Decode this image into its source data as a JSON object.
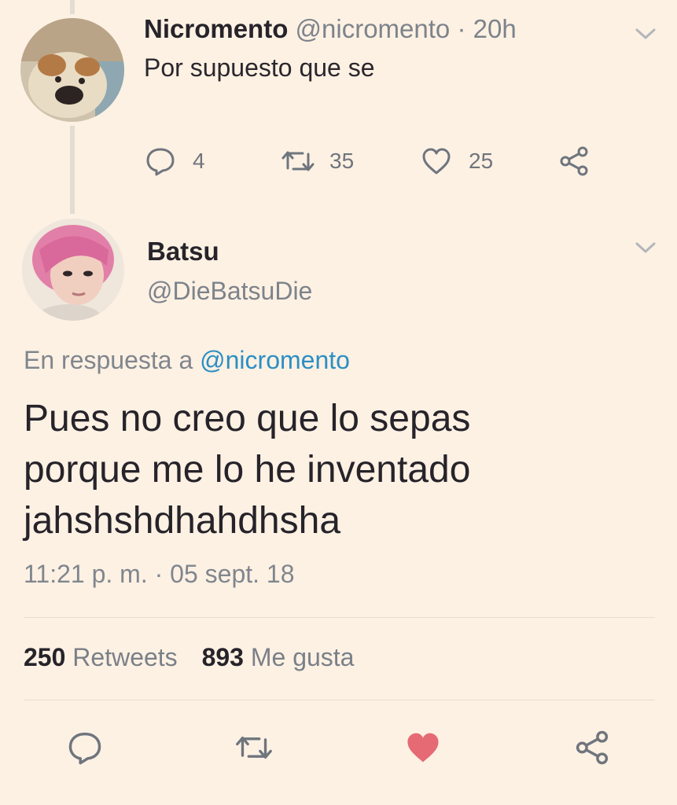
{
  "colors": {
    "background": "#fdf1e3",
    "text": "#26232a",
    "muted": "#7d838b",
    "link": "#2c8fc4",
    "like_active": "#e0245e"
  },
  "parent_tweet": {
    "name": "Nicromento",
    "handle": "@nicromento",
    "separator": "·",
    "time": "20h",
    "text": "Por supuesto que se",
    "replies": "4",
    "retweets": "35",
    "likes": "25",
    "avatar_icon": "bulldog-avatar"
  },
  "main_tweet": {
    "name": "Batsu",
    "handle": "@DieBatsuDie",
    "reply_prefix": "En respuesta a",
    "reply_to": "@nicromento",
    "text_lines": [
      "Pues no creo que lo sepas",
      "porque me lo he inventado",
      "jahshshdhahdhsha"
    ],
    "timestamp": "11:21 p. m. · 05 sept. 18",
    "retweet_count": "250",
    "retweet_label": "Retweets",
    "like_count": "893",
    "like_label": "Me gusta",
    "avatar_icon": "pink-hair-avatar"
  },
  "icons": {
    "reply": "reply-icon",
    "retweet": "retweet-icon",
    "like": "heart-icon",
    "share": "share-icon",
    "menu": "chevron-down-icon"
  }
}
